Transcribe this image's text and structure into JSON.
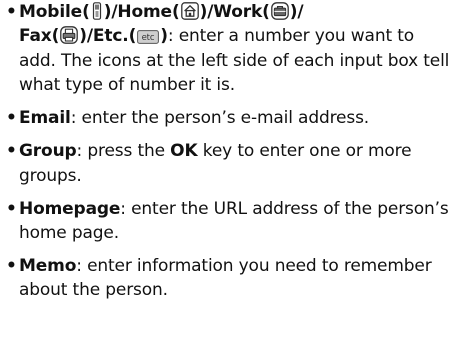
{
  "items": [
    {
      "term_mobile": "Mobile",
      "term_home": "Home",
      "term_work": "Work",
      "term_fax": "Fax",
      "term_etc": "Etc.",
      "desc": ": enter a number you want to add. The icons at the left side of each input box tell what type of number it is.",
      "icons": [
        "mobile-phone-icon",
        "home-icon",
        "work-briefcase-icon",
        "fax-icon",
        "etc-icon"
      ],
      "etc_icon_text": "etc"
    },
    {
      "term": "Email",
      "desc": ": enter the person’s e-mail address."
    },
    {
      "term": "Group",
      "desc_before": ": press the ",
      "key": "OK",
      "desc_after": " key to enter one or more groups."
    },
    {
      "term": "Homepage",
      "desc": ": enter the URL address of the person’s home page."
    },
    {
      "term": "Memo",
      "desc": ": enter information you need to remember about the person."
    }
  ],
  "separators": {
    "slash": "/",
    "open": "(",
    "close": ")"
  },
  "bullet_char": "•"
}
